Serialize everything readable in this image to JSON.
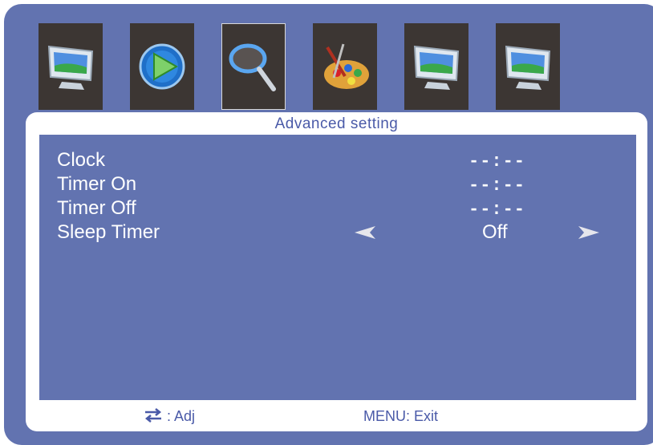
{
  "icons": [
    {
      "name": "display-picture-icon"
    },
    {
      "name": "playback-icon"
    },
    {
      "name": "search-magnifier-icon",
      "selected": true
    },
    {
      "name": "palette-icon"
    },
    {
      "name": "display-picture-icon"
    },
    {
      "name": "display-picture-icon"
    }
  ],
  "panel": {
    "title": "Advanced setting"
  },
  "rows": [
    {
      "label": "Clock",
      "value": "--:--"
    },
    {
      "label": "Timer On",
      "value": "--:--"
    },
    {
      "label": "Timer Off",
      "value": "--:--"
    },
    {
      "label": "Sleep Timer",
      "value": "Off"
    }
  ],
  "footer": {
    "adjust_label": ": Adj",
    "exit_label": "MENU: Exit"
  },
  "colors": {
    "osd_background": "#6273b0",
    "panel_background": "#ffffff",
    "accent_text": "#4a5aa8"
  }
}
